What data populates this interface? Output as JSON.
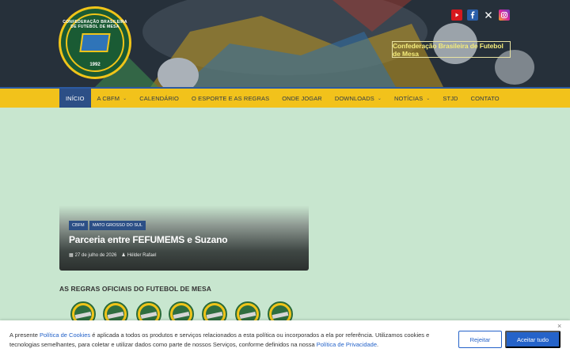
{
  "header": {
    "logo": {
      "circle_text": "CONFEDERAÇÃO BRASILEIRA DE FUTEBOL DE MESA",
      "year": "1992"
    },
    "tagline": "Confederação Brasileira de Futebol de Mesa",
    "social": [
      "youtube-icon",
      "facebook-icon",
      "x-icon",
      "instagram-icon"
    ]
  },
  "nav": {
    "items": [
      {
        "label": "INÍCIO",
        "active": true
      },
      {
        "label": "A CBFM",
        "dropdown": true
      },
      {
        "label": "CALENDÁRIO"
      },
      {
        "label": "O ESPORTE E AS REGRAS"
      },
      {
        "label": "ONDE JOGAR"
      },
      {
        "label": "DOWNLOADS",
        "dropdown": true
      },
      {
        "label": "NOTÍCIAS",
        "dropdown": true
      },
      {
        "label": "STJD"
      },
      {
        "label": "CONTATO"
      }
    ]
  },
  "feature": {
    "tags": [
      "CBFM",
      "MATO GROSSO DO SUL"
    ],
    "title": "Parceria entre FEFUMEMS e Suzano",
    "date": "27 de julho de 2026",
    "author": "Hélder Rafael"
  },
  "rules": {
    "title": "AS REGRAS OFICIAIS DO FUTEBOL DE MESA",
    "icon_count": 7
  },
  "cookie": {
    "text_1": "A presente ",
    "link_1": "Política de Cookies",
    "text_2": " é aplicada a todos os produtos e serviços relacionados a esta política ou incorporados a ela por referência. Utilizamos cookies e tecnologias semelhantes, para coletar e utilizar dados como parte de nossos Serviços, conforme definidos na nossa ",
    "link_2": "Política de Privacidade",
    "text_3": ".",
    "reject_label": "Rejeitar",
    "accept_label": "Aceitar tudo",
    "close": "×"
  },
  "colors": {
    "nav_bg": "#f2c21b",
    "nav_active": "#2c4f86",
    "page_bg": "#c8e6cf",
    "accent": "#2563c9"
  }
}
